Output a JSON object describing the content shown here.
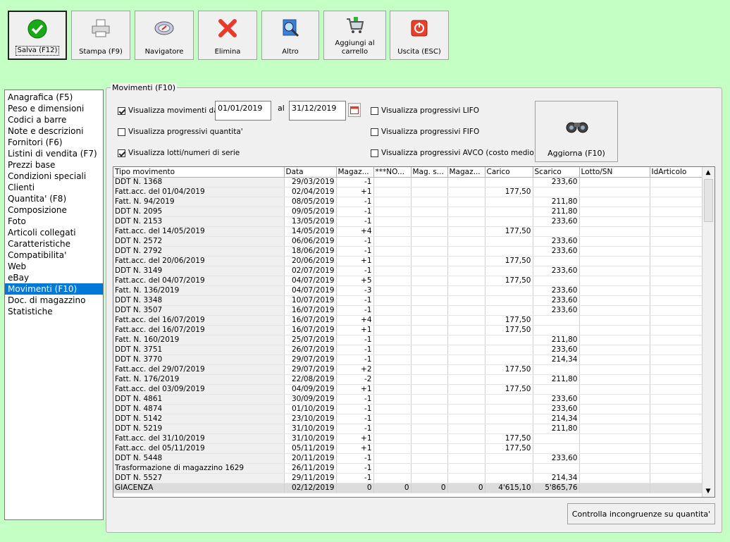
{
  "toolbar": {
    "save": "Salva (F12)",
    "print": "Stampa (F9)",
    "navigator": "Navigatore",
    "delete": "Elimina",
    "other": "Altro",
    "cart_line1": "Aggiungi al",
    "cart_line2": "carrello",
    "exit": "Uscita (ESC)"
  },
  "nav": {
    "items": [
      "Anagrafica (F5)",
      "Peso e dimensioni",
      "Codici a barre",
      "Note e descrizioni",
      "Fornitori (F6)",
      "Listini di vendita (F7)",
      "Prezzi base",
      "Condizioni speciali",
      "Clienti",
      "Quantita' (F8)",
      "Composizione",
      "Foto",
      "Articoli collegati",
      "Caratteristiche",
      "Compatibilita'",
      "Web",
      "eBay",
      "Movimenti (F10)",
      "Doc. di magazzino",
      "Statistiche"
    ],
    "selected": "Movimenti (F10)"
  },
  "panel": {
    "title": "Movimenti (F10)",
    "show_moves_label": "Visualizza movimenti dal",
    "date_from": "01/01/2019",
    "al_label": "al",
    "date_to": "31/12/2019",
    "prog_qty_label": "Visualizza progressivi quantita'",
    "lots_label": "Visualizza lotti/numeri di serie",
    "lifo_label": "Visualizza progressivi LIFO",
    "fifo_label": "Visualizza progressivi FIFO",
    "avco_label": "Visualizza progressivi AVCO (costo medio)",
    "refresh_label": "Aggiorna (F10)",
    "check_button": "Controlla incongruenze su quantita'"
  },
  "table": {
    "headers": [
      "Tipo movimento",
      "Data",
      "Magaz...",
      "***NO...",
      "Mag. s...",
      "Magaz...",
      "Carico",
      "Scarico",
      "Lotto/SN",
      "IdArticolo"
    ],
    "rows": [
      [
        "DDT N. 1368",
        "29/03/2019",
        "-1",
        "",
        "",
        "",
        "",
        "233,60",
        "",
        ""
      ],
      [
        "Fatt.acc. del 01/04/2019",
        "02/04/2019",
        "+1",
        "",
        "",
        "",
        "177,50",
        "",
        "",
        ""
      ],
      [
        "Fatt. N. 94/2019",
        "08/05/2019",
        "-1",
        "",
        "",
        "",
        "",
        "211,80",
        "",
        ""
      ],
      [
        "DDT N. 2095",
        "09/05/2019",
        "-1",
        "",
        "",
        "",
        "",
        "211,80",
        "",
        ""
      ],
      [
        "DDT N. 2153",
        "13/05/2019",
        "-1",
        "",
        "",
        "",
        "",
        "233,60",
        "",
        ""
      ],
      [
        "Fatt.acc. del 14/05/2019",
        "14/05/2019",
        "+4",
        "",
        "",
        "",
        "177,50",
        "",
        "",
        ""
      ],
      [
        "DDT N. 2572",
        "06/06/2019",
        "-1",
        "",
        "",
        "",
        "",
        "233,60",
        "",
        ""
      ],
      [
        "DDT N. 2792",
        "18/06/2019",
        "-1",
        "",
        "",
        "",
        "",
        "233,60",
        "",
        ""
      ],
      [
        "Fatt.acc. del 20/06/2019",
        "20/06/2019",
        "+1",
        "",
        "",
        "",
        "177,50",
        "",
        "",
        ""
      ],
      [
        "DDT N. 3149",
        "02/07/2019",
        "-1",
        "",
        "",
        "",
        "",
        "233,60",
        "",
        ""
      ],
      [
        "Fatt.acc. del 04/07/2019",
        "04/07/2019",
        "+5",
        "",
        "",
        "",
        "177,50",
        "",
        "",
        ""
      ],
      [
        "Fatt. N. 136/2019",
        "04/07/2019",
        "-3",
        "",
        "",
        "",
        "",
        "233,60",
        "",
        ""
      ],
      [
        "DDT N. 3348",
        "10/07/2019",
        "-1",
        "",
        "",
        "",
        "",
        "233,60",
        "",
        ""
      ],
      [
        "DDT N. 3507",
        "16/07/2019",
        "-1",
        "",
        "",
        "",
        "",
        "233,60",
        "",
        ""
      ],
      [
        "Fatt.acc. del 16/07/2019",
        "16/07/2019",
        "+4",
        "",
        "",
        "",
        "177,50",
        "",
        "",
        ""
      ],
      [
        "Fatt.acc. del 16/07/2019",
        "16/07/2019",
        "+1",
        "",
        "",
        "",
        "177,50",
        "",
        "",
        ""
      ],
      [
        "Fatt. N. 160/2019",
        "25/07/2019",
        "-1",
        "",
        "",
        "",
        "",
        "211,80",
        "",
        ""
      ],
      [
        "DDT N. 3751",
        "26/07/2019",
        "-1",
        "",
        "",
        "",
        "",
        "233,60",
        "",
        ""
      ],
      [
        "DDT N. 3770",
        "29/07/2019",
        "-1",
        "",
        "",
        "",
        "",
        "214,34",
        "",
        ""
      ],
      [
        "Fatt.acc. del 29/07/2019",
        "29/07/2019",
        "+2",
        "",
        "",
        "",
        "177,50",
        "",
        "",
        ""
      ],
      [
        "Fatt. N. 176/2019",
        "22/08/2019",
        "-2",
        "",
        "",
        "",
        "",
        "211,80",
        "",
        ""
      ],
      [
        "Fatt.acc. del 03/09/2019",
        "04/09/2019",
        "+1",
        "",
        "",
        "",
        "177,50",
        "",
        "",
        ""
      ],
      [
        "DDT N. 4861",
        "30/09/2019",
        "-1",
        "",
        "",
        "",
        "",
        "233,60",
        "",
        ""
      ],
      [
        "DDT N. 4874",
        "01/10/2019",
        "-1",
        "",
        "",
        "",
        "",
        "233,60",
        "",
        ""
      ],
      [
        "DDT N. 5142",
        "23/10/2019",
        "-1",
        "",
        "",
        "",
        "",
        "214,34",
        "",
        ""
      ],
      [
        "DDT N. 5219",
        "31/10/2019",
        "-1",
        "",
        "",
        "",
        "",
        "211,80",
        "",
        ""
      ],
      [
        "Fatt.acc. del 31/10/2019",
        "31/10/2019",
        "+1",
        "",
        "",
        "",
        "177,50",
        "",
        "",
        ""
      ],
      [
        "Fatt.acc. del 05/11/2019",
        "05/11/2019",
        "+1",
        "",
        "",
        "",
        "177,50",
        "",
        "",
        ""
      ],
      [
        "DDT N. 5448",
        "20/11/2019",
        "-1",
        "",
        "",
        "",
        "",
        "233,60",
        "",
        ""
      ],
      [
        "Trasformazione di magazzino 1629",
        "26/11/2019",
        "-1",
        "",
        "",
        "",
        "",
        "",
        "",
        ""
      ],
      [
        "DDT N. 5527",
        "29/11/2019",
        "-1",
        "",
        "",
        "",
        "",
        "214,34",
        "",
        ""
      ]
    ],
    "total": [
      "GIACENZA",
      "02/12/2019",
      "0",
      "0",
      "0",
      "0",
      "4'615,10",
      "5'865,76",
      "",
      ""
    ]
  }
}
